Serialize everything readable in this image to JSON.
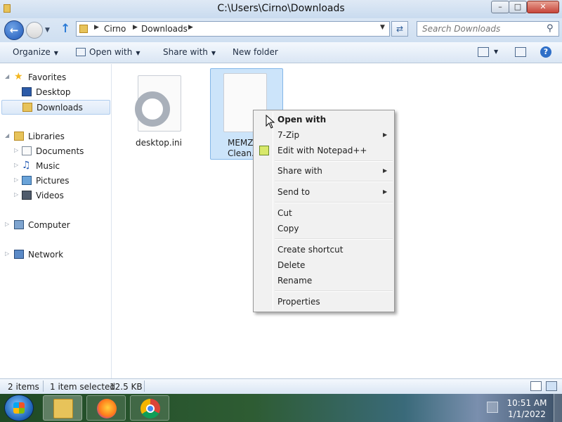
{
  "window": {
    "title": "C:\\Users\\Cirno\\Downloads",
    "minimize_glyph": "–",
    "maximize_glyph": "□",
    "close_glyph": "✕"
  },
  "address": {
    "breadcrumbs": [
      "Cirno",
      "Downloads"
    ],
    "separator": "▶",
    "dropdown_glyph": "▼"
  },
  "search": {
    "placeholder": "Search Downloads"
  },
  "toolbar": {
    "organize_label": "Organize",
    "open_with_label": "Open with",
    "share_with_label": "Share with",
    "new_folder_label": "New folder",
    "help_glyph": "?",
    "caret": "▼"
  },
  "nav_pane": {
    "favorites": "Favorites",
    "desktop": "Desktop",
    "downloads": "Downloads",
    "libraries": "Libraries",
    "documents": "Documents",
    "music": "Music",
    "pictures": "Pictures",
    "videos": "Videos",
    "computer": "Computer",
    "network": "Network",
    "selected_item": "Downloads"
  },
  "files": [
    {
      "label": "desktop.ini",
      "selected": false,
      "icon": "settings-file-icon"
    },
    {
      "label": "MEMZ\nClean.",
      "selected": true,
      "icon": "blank-file-icon"
    }
  ],
  "context_menu": {
    "items": [
      {
        "label": "Open with",
        "bold": true,
        "submenu": false
      },
      {
        "label": "7-Zip",
        "bold": false,
        "submenu": true
      },
      {
        "label": "Edit with Notepad++",
        "bold": false,
        "submenu": false,
        "icon": "notepad-plus-plus-icon"
      },
      {
        "label": "Share with",
        "bold": false,
        "submenu": true
      },
      {
        "label": "Send to",
        "bold": false,
        "submenu": true
      },
      {
        "label": "Cut",
        "bold": false,
        "submenu": false
      },
      {
        "label": "Copy",
        "bold": false,
        "submenu": false
      },
      {
        "label": "Create shortcut",
        "bold": false,
        "submenu": false
      },
      {
        "label": "Delete",
        "bold": false,
        "submenu": false
      },
      {
        "label": "Rename",
        "bold": false,
        "submenu": false
      },
      {
        "label": "Properties",
        "bold": false,
        "submenu": false
      }
    ],
    "submenu_arrow": "▶"
  },
  "status": {
    "item_count": "2 items",
    "selection": "1 item selected",
    "size": "12.5 KB"
  },
  "taskbar": {
    "apps": [
      "Windows Explorer",
      "Firefox",
      "Chrome"
    ],
    "time": "10:51 AM",
    "date": "1/1/2022"
  }
}
